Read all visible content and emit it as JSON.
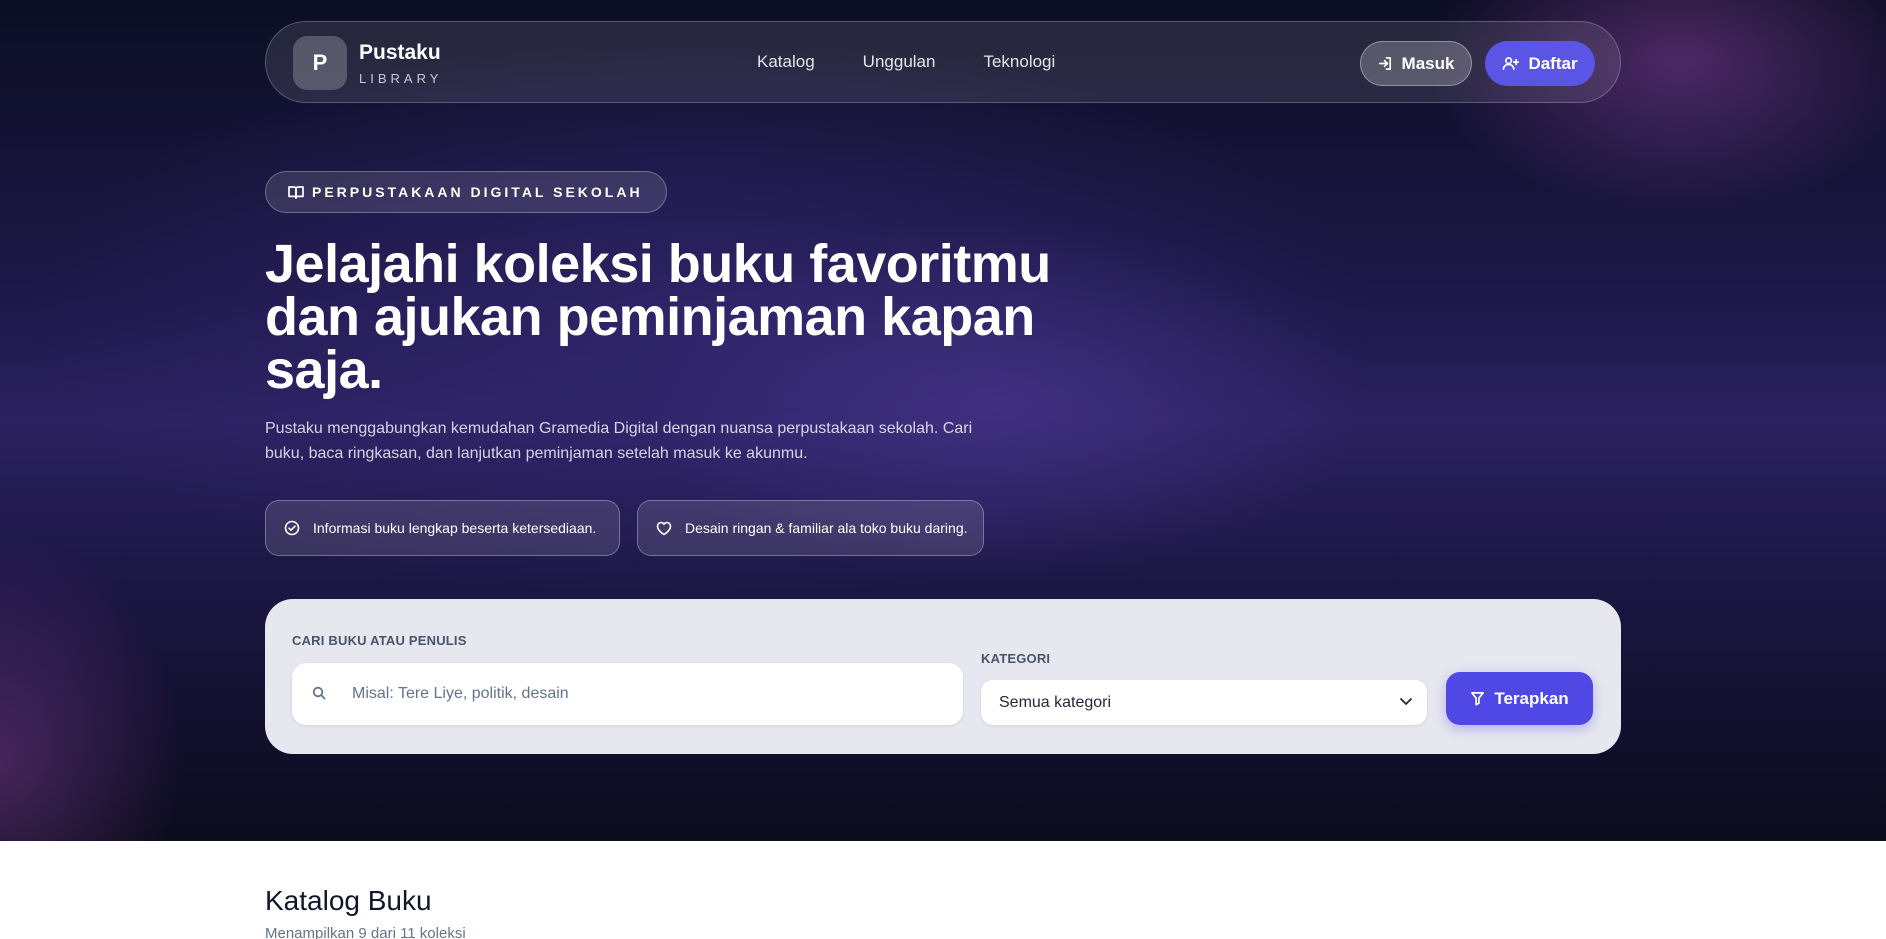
{
  "brand": {
    "initial": "P",
    "name": "Pustaku",
    "subtitle": "LIBRARY"
  },
  "nav": {
    "links": [
      "Katalog",
      "Unggulan",
      "Teknologi"
    ]
  },
  "auth": {
    "login_label": "Masuk",
    "register_label": "Daftar"
  },
  "hero": {
    "badge": "PERPUSTAKAAN DIGITAL SEKOLAH",
    "title": "Jelajahi koleksi buku favoritmu dan ajukan peminjaman kapan saja.",
    "description": "Pustaku menggabungkan kemudahan Gramedia Digital dengan nuansa perpustakaan sekolah. Cari buku, baca ringkasan, dan lanjutkan peminjaman setelah masuk ke akunmu.",
    "features": [
      {
        "icon": "check-circle-icon",
        "text": "Informasi buku lengkap beserta ketersediaan."
      },
      {
        "icon": "heart-icon",
        "text": "Desain ringan & familiar ala toko buku daring."
      }
    ]
  },
  "search": {
    "label": "CARI BUKU ATAU PENULIS",
    "placeholder": "Misal: Tere Liye, politik, desain",
    "value": "",
    "category_label": "KATEGORI",
    "category_selected": "Semua kategori",
    "apply_label": "Terapkan"
  },
  "catalog": {
    "title": "Katalog Buku",
    "subtitle": "Menampilkan 9 dari 11 koleksi"
  },
  "colors": {
    "accent": "#5b55e6",
    "apply_button": "#5048e5",
    "hero_dark": "#0c0e24",
    "hero_mid": "#2b2160",
    "panel": "#e7e7ef"
  }
}
